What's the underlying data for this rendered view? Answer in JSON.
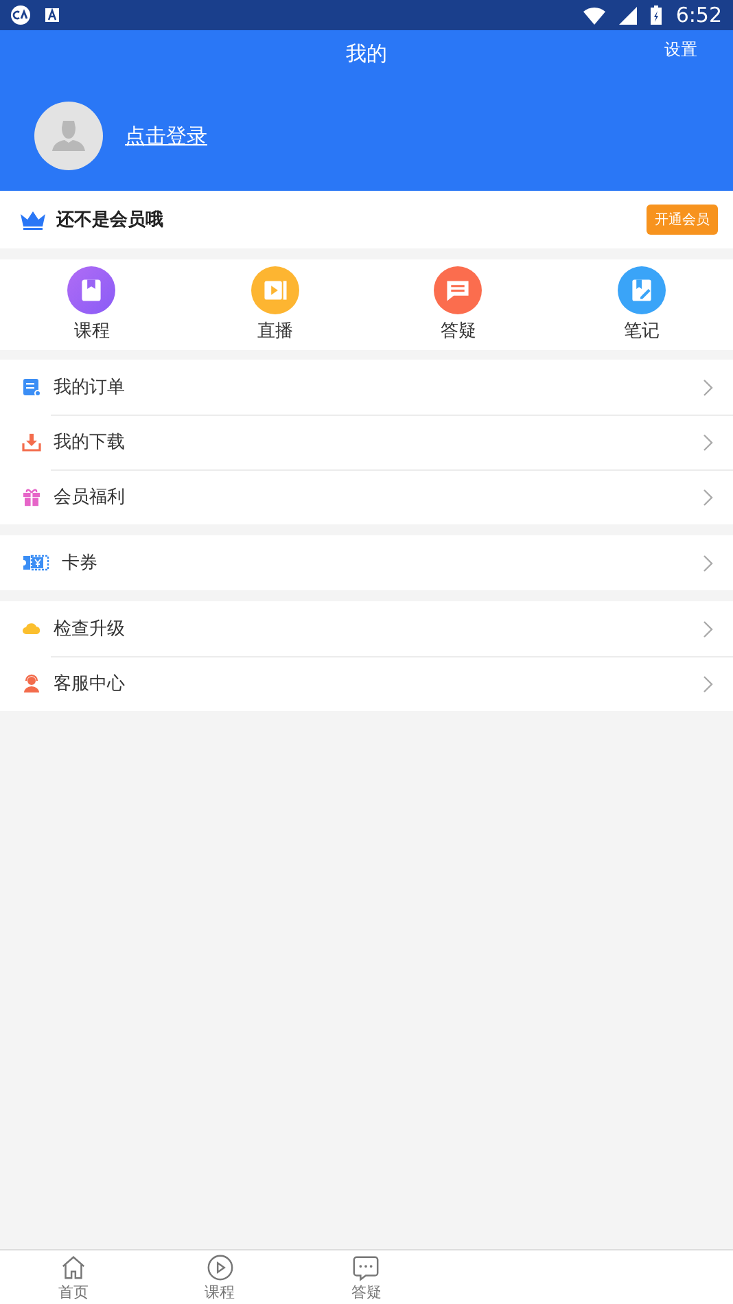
{
  "status_bar": {
    "time": "6:52"
  },
  "header": {
    "title": "我的",
    "settings": "设置",
    "login": "点击登录"
  },
  "membership": {
    "text": "还不是会员哦",
    "button": "开通会员"
  },
  "shortcuts": [
    {
      "kind": "course",
      "label": "课程"
    },
    {
      "kind": "live",
      "label": "直播"
    },
    {
      "kind": "qa",
      "label": "答疑"
    },
    {
      "kind": "notes",
      "label": "笔记"
    }
  ],
  "menu_groups": [
    [
      {
        "kind": "orders",
        "label": "我的订单"
      },
      {
        "kind": "downloads",
        "label": "我的下载"
      },
      {
        "kind": "gift",
        "label": "会员福利"
      }
    ],
    [
      {
        "kind": "coupon",
        "label": "卡券"
      }
    ],
    [
      {
        "kind": "cloud",
        "label": "检查升级"
      },
      {
        "kind": "service",
        "label": "客服中心"
      }
    ]
  ],
  "bottom_nav": [
    {
      "kind": "home",
      "label": "首页",
      "selected": false
    },
    {
      "kind": "course",
      "label": "课程",
      "selected": false
    },
    {
      "kind": "qa",
      "label": "答疑",
      "selected": false
    }
  ]
}
